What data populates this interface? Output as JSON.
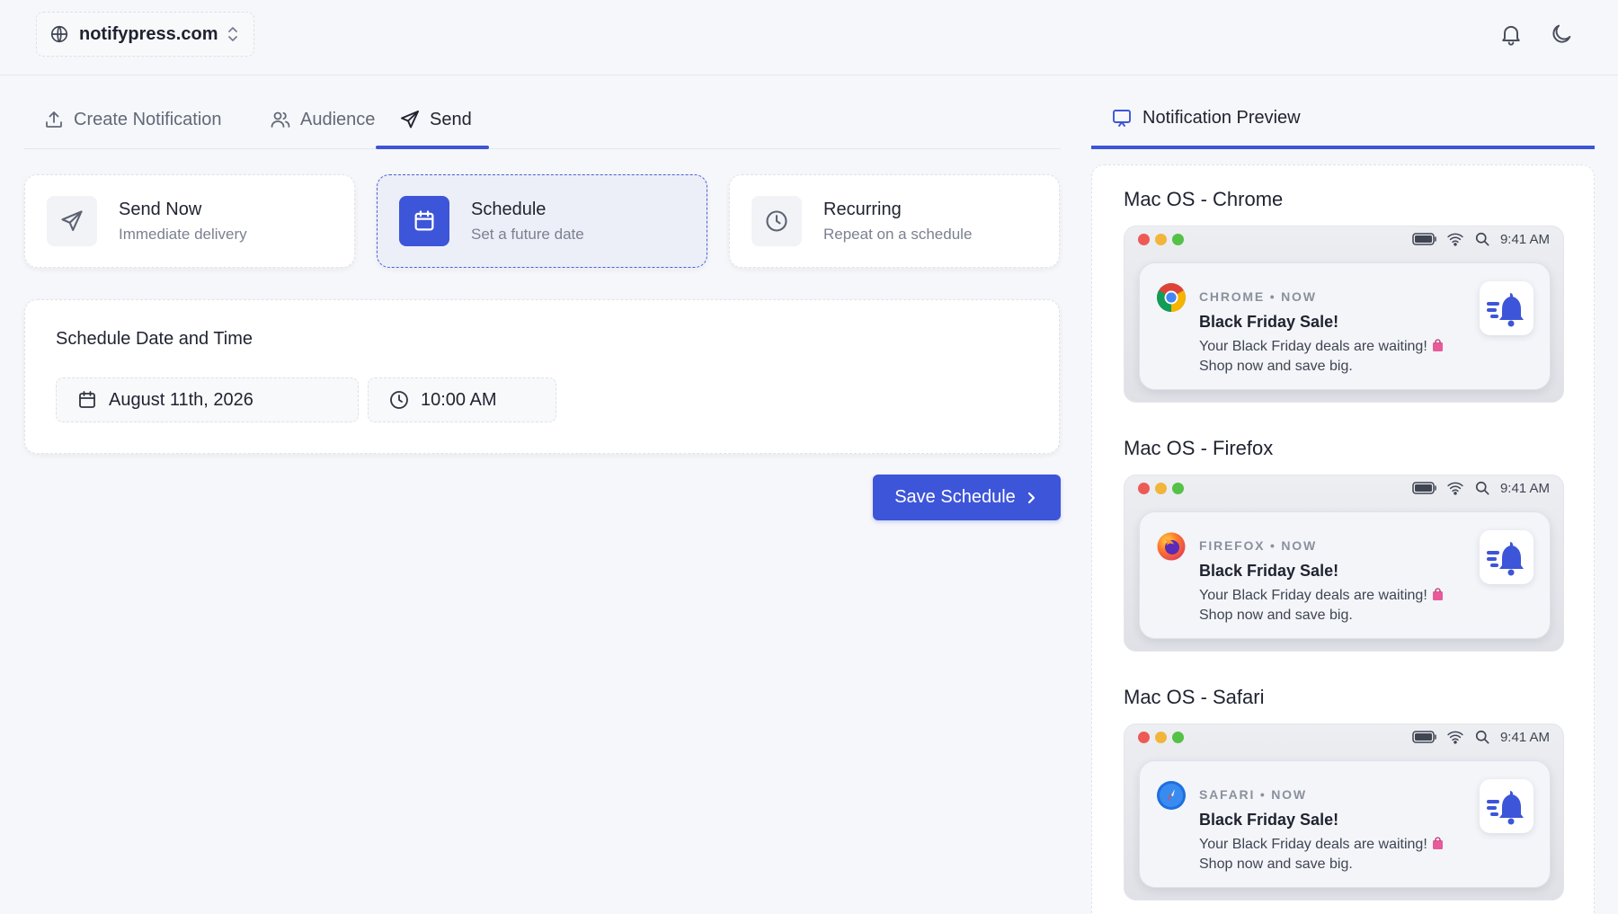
{
  "header": {
    "site": "notifypress.com",
    "icons": [
      "globe-icon",
      "chevron-up-down-icon",
      "bell-icon",
      "moon-icon"
    ]
  },
  "tabs": [
    {
      "label": "Create Notification",
      "icon": "upload-icon",
      "active": false
    },
    {
      "label": "Audience",
      "icon": "users-icon",
      "active": false
    },
    {
      "label": "Send",
      "icon": "send-icon",
      "active": true
    }
  ],
  "send_options": [
    {
      "title": "Send Now",
      "subtitle": "Immediate delivery",
      "icon": "send-icon",
      "selected": false
    },
    {
      "title": "Schedule",
      "subtitle": "Set a future date",
      "icon": "calendar-icon",
      "selected": true
    },
    {
      "title": "Recurring",
      "subtitle": "Repeat on a schedule",
      "icon": "clock-icon",
      "selected": false
    }
  ],
  "schedule": {
    "title": "Schedule Date and Time",
    "date": "August 11th, 2026",
    "time": "10:00 AM"
  },
  "save_button": "Save Schedule",
  "preview": {
    "tab_label": "Notification Preview",
    "items": [
      {
        "title": "Mac OS - Chrome",
        "clock": "9:41 AM",
        "meta": "CHROME • NOW",
        "notif_title": "Black Friday Sale!",
        "body_line1": "Your Black Friday deals are waiting!",
        "body_line2": "Shop now and save big.",
        "logo": "chrome-icon"
      },
      {
        "title": "Mac OS - Firefox",
        "clock": "9:41 AM",
        "meta": "FIREFOX • NOW",
        "notif_title": "Black Friday Sale!",
        "body_line1": "Your Black Friday deals are waiting!",
        "body_line2": "Shop now and save big.",
        "logo": "firefox-icon"
      },
      {
        "title": "Mac OS - Safari",
        "clock": "9:41 AM",
        "meta": "SAFARI • NOW",
        "notif_title": "Black Friday Sale!",
        "body_line1": "Your Black Friday deals are waiting!",
        "body_line2": "Shop now and save big.",
        "logo": "safari-icon"
      }
    ]
  },
  "colors": {
    "accent": "#3d55d8",
    "background": "#f6f7fa",
    "card": "#ffffff",
    "muted_text": "#7b8190"
  }
}
